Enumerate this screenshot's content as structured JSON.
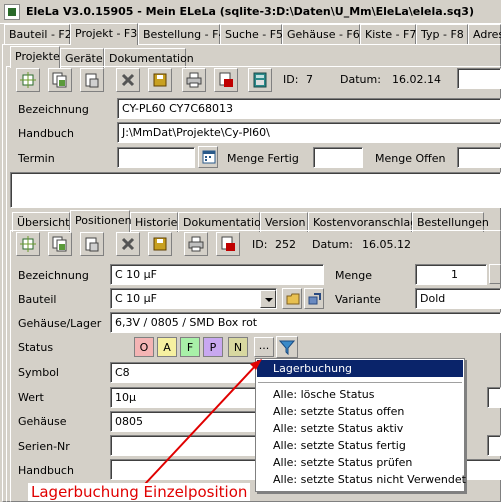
{
  "window": {
    "title": "EleLa V3.0.15905  -  Mein ELeLa (sqlite-3:D:\\Daten\\U_Mm\\EleLa\\elela.sq3)"
  },
  "main_tabs": [
    "Bauteil - F2",
    "Projekt - F3",
    "Bestellung - F4",
    "Suche - F5",
    "Gehäuse - F6",
    "Kiste - F7",
    "Typ - F8",
    "Adress"
  ],
  "sub_tabs": [
    "Projekte",
    "Geräte",
    "Dokumentation"
  ],
  "project": {
    "id_label": "ID:",
    "id_value": "7",
    "date_label": "Datum:",
    "date_value": "16.02.14",
    "bezeichnung_label": "Bezeichnung",
    "bezeichnung_value": "CY-PL60 CY7C68013",
    "handbuch_label": "Handbuch",
    "handbuch_value": "J:\\MmDat\\Projekte\\Cy-Pl60\\",
    "termin_label": "Termin",
    "menge_fertig_label": "Menge Fertig",
    "menge_offen_label": "Menge Offen"
  },
  "pos_tabs": [
    "Übersicht",
    "Positionen",
    "Historie",
    "Dokumentation",
    "Version",
    "Kostenvoranschlag",
    "Bestellungen"
  ],
  "position": {
    "id_label": "ID:",
    "id_value": "252",
    "date_label": "Datum:",
    "date_value": "16.05.12",
    "bezeichnung_label": "Bezeichnung",
    "bezeichnung_value": "C 10 µF",
    "menge_label": "Menge",
    "menge_value": "1",
    "bauteil_label": "Bauteil",
    "bauteil_value": "C 10 µF",
    "variante_label": "Variante",
    "variante_value": "Dold",
    "gehaeuse_lager_label": "Gehäuse/Lager",
    "gehaeuse_lager_value": "6,3V / 0805 / SMD Box rot",
    "status_label": "Status",
    "status_buttons": [
      {
        "label": "O",
        "color": "#f4b4b4"
      },
      {
        "label": "A",
        "color": "#f6f0a0"
      },
      {
        "label": "F",
        "color": "#a8f0a8"
      },
      {
        "label": "P",
        "color": "#c8a8f0"
      },
      {
        "label": "N",
        "color": "#d8d8a0"
      }
    ],
    "more_label": "...",
    "symbol_label": "Symbol",
    "symbol_value": "C8",
    "wert_label": "Wert",
    "wert_value": "10µ",
    "gehaeuse_label": "Gehäuse",
    "gehaeuse_value": "0805",
    "serien_label": "Serien-Nr",
    "handbuch_label": "Handbuch"
  },
  "menu": {
    "items": [
      "Lagerbuchung",
      "Alle: lösche Status",
      "Alle: setzte Status offen",
      "Alle: setzte Status aktiv",
      "Alle: setzte Status fertig",
      "Alle: setzte Status prüfen",
      "Alle: setzte Status nicht Verwendet"
    ]
  },
  "annotation": "Lagerbuchung Einzelposition",
  "colors": {
    "selection": "#0a246a",
    "annotation": "#e00000",
    "face": "#d4d0c8"
  }
}
